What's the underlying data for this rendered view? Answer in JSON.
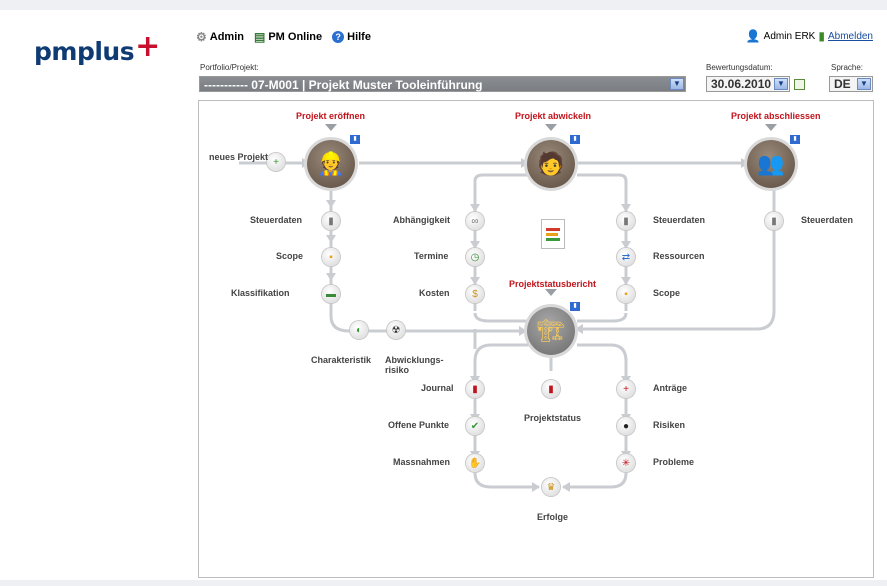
{
  "brand": {
    "logo_main": "pmplus",
    "logo_plus": "+"
  },
  "topnav": [
    {
      "label": "Admin",
      "icon": "gear-icon"
    },
    {
      "label": "PM Online",
      "icon": "document-icon"
    },
    {
      "label": "Hilfe",
      "icon": "help-icon"
    }
  ],
  "user": {
    "name": "Admin ERK",
    "logout": "Abmelden"
  },
  "form": {
    "project_label": "Portfolio/Projekt:",
    "project_value": "----------- 07-M001 | Projekt Muster Tooleinführung",
    "date_label": "Bewertungsdatum:",
    "date_value": "30.06.2010",
    "lang_label": "Sprache:",
    "lang_value": "DE"
  },
  "phases": {
    "open": "Projekt eröffnen",
    "run": "Projekt abwickeln",
    "close": "Projekt abschliessen",
    "report": "Projektstatusbericht"
  },
  "nodes": {
    "new_project": "neues Projekt",
    "open": [
      "Steuerdaten",
      "Scope",
      "Klassifikation"
    ],
    "charakteristik": "Charakteristik",
    "abwicklungsrisiko": "Abwicklungs- risiko",
    "run_left": [
      "Abhängigkeit",
      "Termine",
      "Kosten"
    ],
    "run_right": [
      "Steuerdaten",
      "Ressourcen",
      "Scope"
    ],
    "close_right": "Steuerdaten",
    "report_left": [
      "Journal",
      "Offene Punkte",
      "Massnahmen"
    ],
    "report_right": [
      "Anträge",
      "Risiken",
      "Probleme"
    ],
    "projektstatus": "Projektstatus",
    "erfolge": "Erfolge"
  },
  "colors": {
    "phase_red": "#c0141c",
    "nav_blue": "#0f3b73",
    "link_blue": "#1a4ea0"
  }
}
